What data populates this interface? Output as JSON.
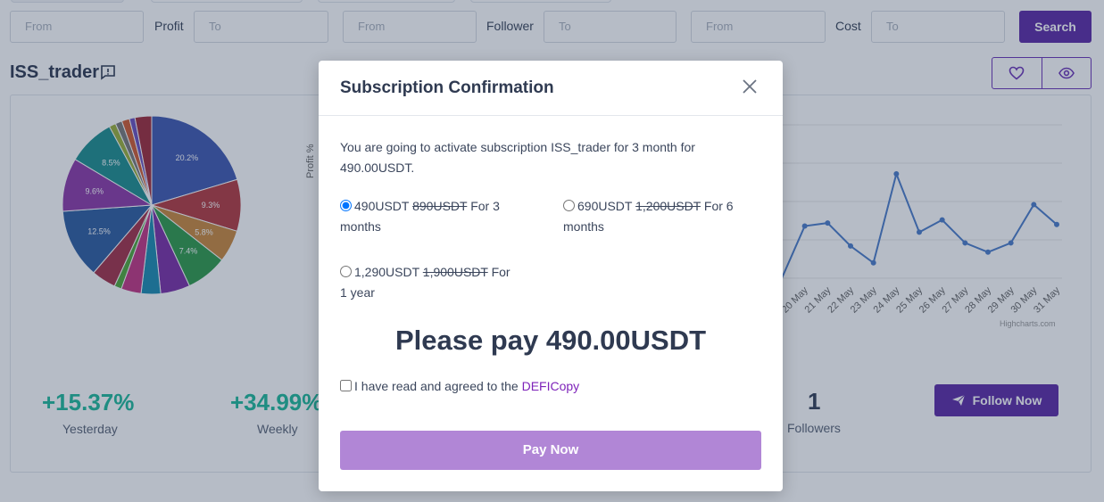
{
  "filters": {
    "profit": {
      "label": "Profit",
      "from_placeholder": "From",
      "to_placeholder": "To"
    },
    "follower": {
      "label": "Follower",
      "from_placeholder": "From",
      "to_placeholder": "To"
    },
    "cost": {
      "label": "Cost",
      "from_placeholder": "From",
      "to_placeholder": "To"
    },
    "search_label": "Search"
  },
  "trader": {
    "name": "ISS_trader",
    "icons": [
      "message-icon",
      "heart-icon",
      "eye-icon"
    ]
  },
  "pie_chart": {
    "type": "pie",
    "labels": [
      "20.2%",
      "9.3%",
      "5.8%",
      "7.4%",
      "12.5%",
      "9.6%",
      "8.5%"
    ],
    "slices": [
      {
        "value": 20.2,
        "color": "#3f58b0",
        "label": "20.2%"
      },
      {
        "value": 9.3,
        "color": "#b33a3f",
        "label": "9.3%"
      },
      {
        "value": 5.8,
        "color": "#c9883c",
        "label": "5.8%"
      },
      {
        "value": 7.4,
        "color": "#2f9a4a",
        "label": "7.4%"
      },
      {
        "value": 5.3,
        "color": "#7b2fa6"
      },
      {
        "value": 3.5,
        "color": "#1c8bb0"
      },
      {
        "value": 3.6,
        "color": "#c23582"
      },
      {
        "value": 1.3,
        "color": "#4fa83a"
      },
      {
        "value": 4.4,
        "color": "#a33048"
      },
      {
        "value": 12.5,
        "color": "#2d5da0",
        "label": "12.5%"
      },
      {
        "value": 9.6,
        "color": "#8d3aa8",
        "label": "9.6%"
      },
      {
        "value": 8.5,
        "color": "#1d8e8e",
        "label": "8.5%"
      },
      {
        "value": 1.2,
        "color": "#9bb03a"
      },
      {
        "value": 1.2,
        "color": "#7a7a7a"
      },
      {
        "value": 1.4,
        "color": "#d05a30"
      },
      {
        "value": 1.0,
        "color": "#6b4fbf"
      },
      {
        "value": 3.0,
        "color": "#9e2a3a"
      }
    ]
  },
  "chart_data": {
    "type": "line",
    "ylabel": "Profit %",
    "x": [
      "20 May",
      "21 May",
      "22 May",
      "23 May",
      "24 May",
      "25 May",
      "26 May",
      "27 May",
      "28 May",
      "29 May",
      "30 May",
      "31 May"
    ],
    "values": [
      0.0,
      3.4,
      3.6,
      2.1,
      1.0,
      6.8,
      3.0,
      3.8,
      2.3,
      1.7,
      2.3,
      4.8,
      3.5
    ],
    "ylim": [
      0,
      10
    ],
    "grid": true,
    "credits": "Highcharts.com",
    "line_color": "#4b7dc9"
  },
  "stats": {
    "yesterday": {
      "value": "+15.37%",
      "label": "Yesterday"
    },
    "weekly": {
      "value": "+34.99%",
      "label": "Weekly"
    },
    "followers": {
      "value": "1",
      "label": "Followers"
    },
    "follow_button": "Follow Now"
  },
  "modal": {
    "title": "Subscription Confirmation",
    "description": "You are going to activate subscription ISS_trader for 3 month for 490.00USDT.",
    "options": [
      {
        "price": "490USDT",
        "old_price": "890USDT",
        "duration": " For 3 months",
        "selected": true
      },
      {
        "price": "690USDT",
        "old_price": "1,200USDT",
        "duration": " For 6 months",
        "selected": false
      },
      {
        "price": "1,290USDT",
        "old_price": "1,900USDT",
        "duration": " For 1 year",
        "selected": false
      }
    ],
    "pay_amount": "Please pay 490.00USDT",
    "agree_text": "I have read and agreed to the ",
    "agree_link": "DEFICopy",
    "pay_button": "Pay Now"
  },
  "colors": {
    "accent": "#5b2aa6",
    "pay_button": "#b186d6",
    "positive": "#1eb99a",
    "link": "#7d22b9"
  }
}
